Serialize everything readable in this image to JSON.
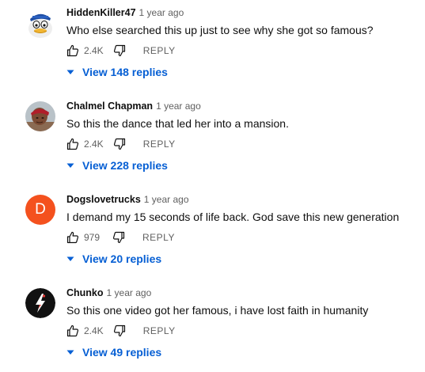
{
  "colors": {
    "link_blue": "#065fd4",
    "meta_gray": "#606060",
    "text": "#0f0f0f",
    "avatar_d_orange": "#f4511e"
  },
  "comments": [
    {
      "author": "HiddenKiller47",
      "time": "1 year ago",
      "text": "Who else searched this up just to see why she got so famous?",
      "likes": "2.4K",
      "reply_label": "REPLY",
      "replies_label": "View 148 replies",
      "avatar_icon": "duck-cartoon-avatar"
    },
    {
      "author": "Chalmel Chapman",
      "time": "1 year ago",
      "text": "So this the dance that led her into a mansion.",
      "likes": "2.4K",
      "reply_label": "REPLY",
      "replies_label": "View 228 replies",
      "avatar_icon": "person-photo-avatar"
    },
    {
      "author": "Dogslovetrucks",
      "time": "1 year ago",
      "text": "I demand my 15 seconds of life back. God save this new generation",
      "likes": "979",
      "reply_label": "REPLY",
      "replies_label": "View 20 replies",
      "avatar_letter": "D"
    },
    {
      "author": "Chunko",
      "time": "1 year ago",
      "text": "So this one video got her famous, i have lost faith in humanity",
      "likes": "2.4K",
      "reply_label": "REPLY",
      "replies_label": "View 49 replies",
      "avatar_icon": "lightning-logo-avatar"
    }
  ]
}
